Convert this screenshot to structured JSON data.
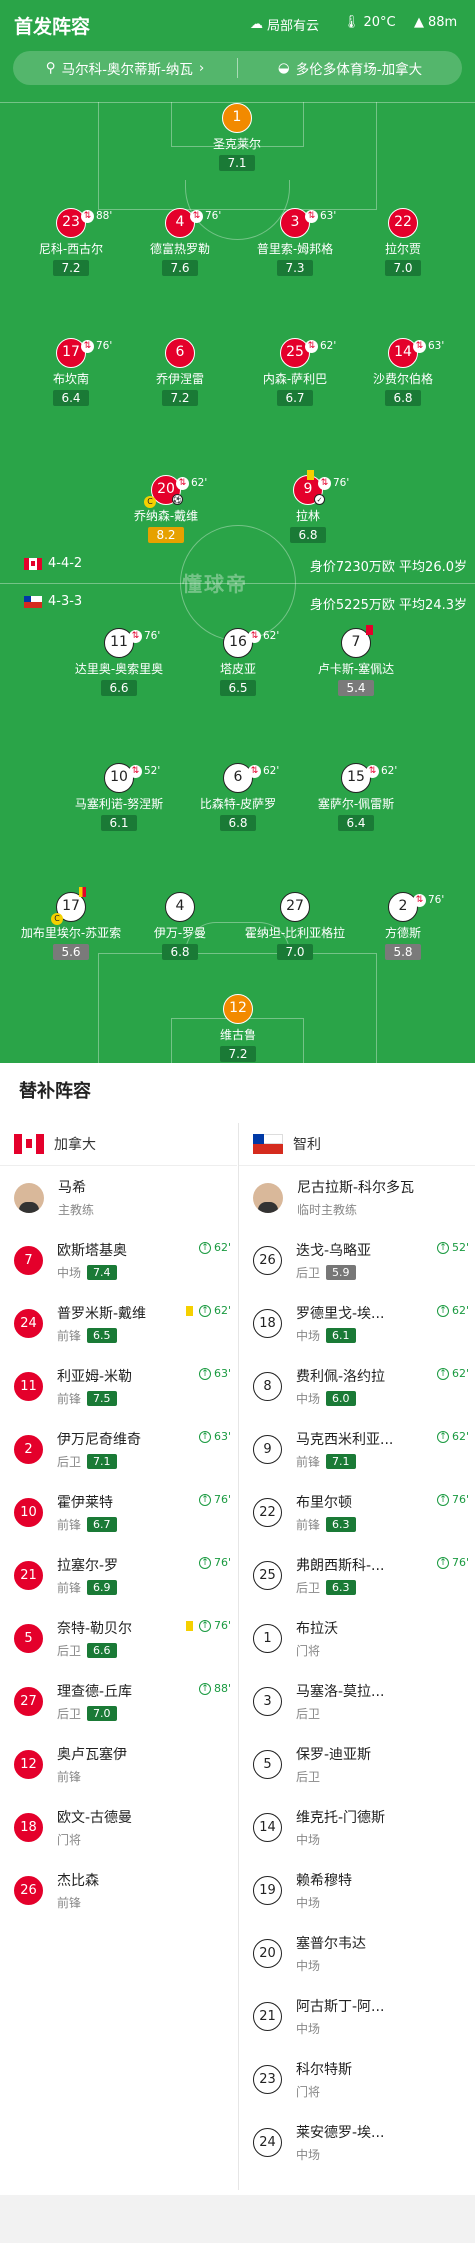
{
  "header": {
    "title": "首发阵容",
    "weather": "局部有云",
    "temperature": "20°C",
    "altitude": "88m"
  },
  "match_info": {
    "referee": "马尔科-奥尔蒂斯-纳瓦",
    "venue": "多伦多体育场-加拿大"
  },
  "watermark": "懂球帝",
  "teams": {
    "home": {
      "name": "加拿大",
      "formation": "4-4-2",
      "value_text": "身价7230万欧 平均26.0岁"
    },
    "away": {
      "name": "智利",
      "formation": "4-3-3",
      "value_text": "身价5225万欧 平均24.3岁"
    }
  },
  "home_lineup": [
    {
      "num": "1",
      "name": "圣克莱尔",
      "rating": "7.1"
    },
    {
      "num": "23",
      "name": "尼科-西古尔",
      "rating": "7.2",
      "sub": "88'"
    },
    {
      "num": "4",
      "name": "德富热罗勒",
      "rating": "7.6",
      "sub": "76'"
    },
    {
      "num": "3",
      "name": "普里索-姆邦格",
      "rating": "7.3",
      "sub": "63'"
    },
    {
      "num": "22",
      "name": "拉尔贾",
      "rating": "7.0"
    },
    {
      "num": "17",
      "name": "布坎南",
      "rating": "6.4",
      "sub": "76'"
    },
    {
      "num": "6",
      "name": "乔伊涅雷",
      "rating": "7.2"
    },
    {
      "num": "25",
      "name": "内森-萨利巴",
      "rating": "6.7",
      "sub": "62'"
    },
    {
      "num": "14",
      "name": "沙费尔伯格",
      "rating": "6.8",
      "sub": "63'"
    },
    {
      "num": "20",
      "name": "乔纳森-戴维",
      "rating": "8.2",
      "sub": "62'"
    },
    {
      "num": "9",
      "name": "拉林",
      "rating": "6.8",
      "sub": "76'"
    }
  ],
  "away_lineup": [
    {
      "num": "11",
      "name": "达里奥-奥索里奥",
      "rating": "6.6",
      "sub": "76'"
    },
    {
      "num": "16",
      "name": "塔皮亚",
      "rating": "6.5",
      "sub": "62'"
    },
    {
      "num": "7",
      "name": "卢卡斯-塞佩达",
      "rating": "5.4"
    },
    {
      "num": "10",
      "name": "马塞利诺-努涅斯",
      "rating": "6.1",
      "sub": "52'"
    },
    {
      "num": "6",
      "name": "比森特-皮萨罗",
      "rating": "6.8",
      "sub": "62'"
    },
    {
      "num": "15",
      "name": "塞萨尔-佩雷斯",
      "rating": "6.4",
      "sub": "62'"
    },
    {
      "num": "17",
      "name": "加布里埃尔-苏亚索",
      "rating": "5.6"
    },
    {
      "num": "4",
      "name": "伊万-罗曼",
      "rating": "6.8"
    },
    {
      "num": "27",
      "name": "霍纳坦-比利亚格拉",
      "rating": "7.0"
    },
    {
      "num": "2",
      "name": "方德斯",
      "rating": "5.8",
      "sub": "76'"
    },
    {
      "num": "12",
      "name": "维古鲁",
      "rating": "7.2"
    }
  ],
  "subs_title": "替补阵容",
  "home_coach": {
    "name": "马希",
    "role": "主教练"
  },
  "away_coach": {
    "name": "尼古拉斯-科尔多瓦",
    "role": "临时主教练"
  },
  "home_subs": [
    {
      "num": "7",
      "name": "欧斯塔基奥",
      "pos": "中场",
      "rating": "7.4",
      "in": "62'"
    },
    {
      "num": "24",
      "name": "普罗米斯-戴维",
      "pos": "前锋",
      "rating": "6.5",
      "in": "62'"
    },
    {
      "num": "11",
      "name": "利亚姆-米勒",
      "pos": "前锋",
      "rating": "7.5",
      "in": "63'"
    },
    {
      "num": "2",
      "name": "伊万尼奇维奇",
      "pos": "后卫",
      "rating": "7.1",
      "in": "63'"
    },
    {
      "num": "10",
      "name": "霍伊莱特",
      "pos": "前锋",
      "rating": "6.7",
      "in": "76'"
    },
    {
      "num": "21",
      "name": "拉塞尔-罗",
      "pos": "前锋",
      "rating": "6.9",
      "in": "76'"
    },
    {
      "num": "5",
      "name": "奈特-勒贝尔",
      "pos": "后卫",
      "rating": "6.6",
      "in": "76'"
    },
    {
      "num": "27",
      "name": "理查德-丘库",
      "pos": "后卫",
      "rating": "7.0",
      "in": "88'"
    },
    {
      "num": "12",
      "name": "奥卢瓦塞伊",
      "pos": "前锋"
    },
    {
      "num": "18",
      "name": "欧文-古德曼",
      "pos": "门将"
    },
    {
      "num": "26",
      "name": "杰比森",
      "pos": "前锋"
    }
  ],
  "away_subs": [
    {
      "num": "26",
      "name": "迭戈-乌略亚",
      "pos": "后卫",
      "rating": "5.9",
      "in": "52'"
    },
    {
      "num": "18",
      "name": "罗德里戈-埃...",
      "pos": "中场",
      "rating": "6.1",
      "in": "62'"
    },
    {
      "num": "8",
      "name": "费利佩-洛约拉",
      "pos": "中场",
      "rating": "6.0",
      "in": "62'"
    },
    {
      "num": "9",
      "name": "马克西米利亚...",
      "pos": "前锋",
      "rating": "7.1",
      "in": "62'"
    },
    {
      "num": "22",
      "name": "布里尔顿",
      "pos": "前锋",
      "rating": "6.3",
      "in": "76'"
    },
    {
      "num": "25",
      "name": "弗朗西斯科-...",
      "pos": "后卫",
      "rating": "6.3",
      "in": "76'"
    },
    {
      "num": "1",
      "name": "布拉沃",
      "pos": "门将"
    },
    {
      "num": "3",
      "name": "马塞洛-莫拉...",
      "pos": "后卫"
    },
    {
      "num": "5",
      "name": "保罗-迪亚斯",
      "pos": "后卫"
    },
    {
      "num": "14",
      "name": "维克托-门德斯",
      "pos": "中场"
    },
    {
      "num": "19",
      "name": "赖希穆特",
      "pos": "中场"
    },
    {
      "num": "20",
      "name": "塞普尔韦达",
      "pos": "中场"
    },
    {
      "num": "21",
      "name": "阿古斯丁-阿...",
      "pos": "中场"
    },
    {
      "num": "23",
      "name": "科尔特斯",
      "pos": "门将"
    },
    {
      "num": "24",
      "name": "莱安德罗-埃...",
      "pos": "中场"
    }
  ],
  "colors": {
    "pitch": "#2aa448",
    "home": "#e4002b",
    "rating": "#1a7a36",
    "gk": "#f28a00"
  }
}
